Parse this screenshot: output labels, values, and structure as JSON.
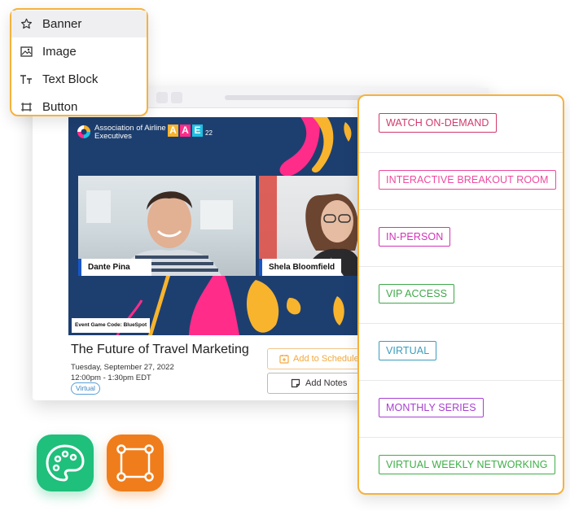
{
  "block_menu": {
    "items": [
      {
        "label": "Banner",
        "icon": "star-icon",
        "highlighted": true
      },
      {
        "label": "Image",
        "icon": "image-icon",
        "highlighted": false
      },
      {
        "label": "Text Block",
        "icon": "text-size-icon",
        "highlighted": false
      },
      {
        "label": "Button",
        "icon": "button-frame-icon",
        "highlighted": false
      }
    ]
  },
  "banner": {
    "org_name": "Association of Airline Executives",
    "event_logo": {
      "letters": [
        "A",
        "A",
        "E"
      ],
      "year": "22",
      "colors": [
        "#f8b42d",
        "#ff2c8a",
        "#1fc0e3"
      ]
    },
    "speakers": [
      {
        "name": "Dante Pina"
      },
      {
        "name": "Shela Bloomfield"
      }
    ],
    "game_code": "Event Game Code: BlueSpot"
  },
  "event": {
    "title": "The Future of Travel Marketing",
    "date": "Tuesday, September 27, 2022",
    "time": "12:00pm - 1:30pm EDT",
    "chip": "Virtual",
    "add_to_schedule_label": "Add to Schedule",
    "add_notes_label": "Add Notes"
  },
  "tags": [
    {
      "label": "WATCH ON-DEMAND",
      "color": "#d23a6a"
    },
    {
      "label": "INTERACTIVE BREAKOUT ROOM",
      "color": "#ee4aa0"
    },
    {
      "label": "IN-PERSON",
      "color": "#d233b8"
    },
    {
      "label": "VIP ACCESS",
      "color": "#3fa84a"
    },
    {
      "label": "VIRTUAL",
      "color": "#3a9dbe"
    },
    {
      "label": "MONTHLY SERIES",
      "color": "#a83fd0"
    },
    {
      "label": "VIRTUAL WEEKLY NETWORKING",
      "color": "#3fae48"
    }
  ],
  "app_icons": [
    {
      "name": "palette-app-icon",
      "color": "#1fbf7c"
    },
    {
      "name": "frame-app-icon",
      "color": "#f07d1b"
    }
  ],
  "colors": {
    "accent": "#f6b23a",
    "banner_bg": "#1d3f70"
  }
}
